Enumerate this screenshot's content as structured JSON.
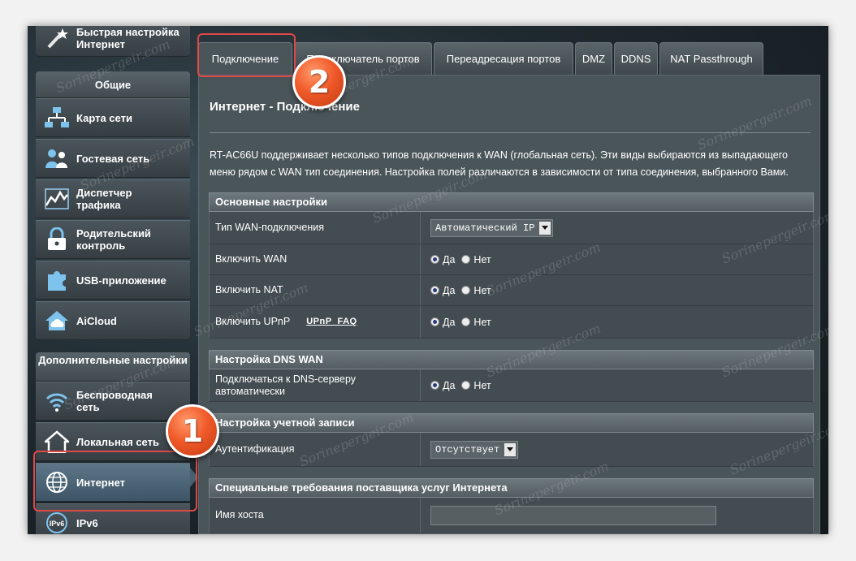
{
  "sidebar": {
    "quick_setup": "Быстрая настройка Интернет",
    "general_header": "Общие",
    "general_items": [
      {
        "label": "Карта сети",
        "icon": "network-map-icon"
      },
      {
        "label": "Гостевая сеть",
        "icon": "guest-network-icon"
      },
      {
        "label": "Диспетчер трафика",
        "icon": "traffic-manager-icon"
      },
      {
        "label": "Родительский контроль",
        "icon": "lock-icon"
      },
      {
        "label": "USB-приложение",
        "icon": "puzzle-icon"
      },
      {
        "label": "AiCloud",
        "icon": "cloud-icon"
      }
    ],
    "advanced_header": "Дополнительные настройки",
    "advanced_items": [
      {
        "label": "Беспроводная сеть",
        "icon": "wifi-icon"
      },
      {
        "label": "Локальная сеть",
        "icon": "home-icon"
      },
      {
        "label": "Интернет",
        "icon": "globe-icon"
      },
      {
        "label": "IPv6",
        "icon": "ipv6-icon"
      }
    ]
  },
  "tabs": [
    "Подключение",
    "Переключатель портов",
    "Переадресация портов",
    "DMZ",
    "DDNS",
    "NAT Passthrough"
  ],
  "main": {
    "title": "Интернет - Подключение",
    "description": "RT-AC66U поддерживает несколько типов подключения к WAN (глобальная сеть). Эти виды выбираются из выпадающего меню рядом с WAN тип соединения. Настройка полей различаются в зависимости от типа соединения, выбранного Вами.",
    "basic": {
      "header": "Основные настройки",
      "wan_type_label": "Тип WAN-подключения",
      "wan_type_value": "Автоматический IP",
      "enable_wan_label": "Включить WAN",
      "enable_nat_label": "Включить NAT",
      "enable_upnp_label": "Включить UPnP",
      "upnp_faq": "UPnP  FAQ"
    },
    "dns": {
      "header": "Настройка DNS WAN",
      "auto_dns_label": "Подключаться к DNS-серверу автоматически"
    },
    "account": {
      "header": "Настройка учетной записи",
      "auth_label": "Аутентификация",
      "auth_value": "Отсутствует"
    },
    "isp": {
      "header": "Специальные требования поставщика услуг Интернета",
      "hostname_label": "Имя хоста",
      "hostname_value": ""
    },
    "yes": "Да",
    "no": "Нет"
  },
  "annotations": {
    "badge_1": "1",
    "badge_2": "2",
    "color": "#e04848"
  },
  "watermark": "Sorinepergeir.com"
}
